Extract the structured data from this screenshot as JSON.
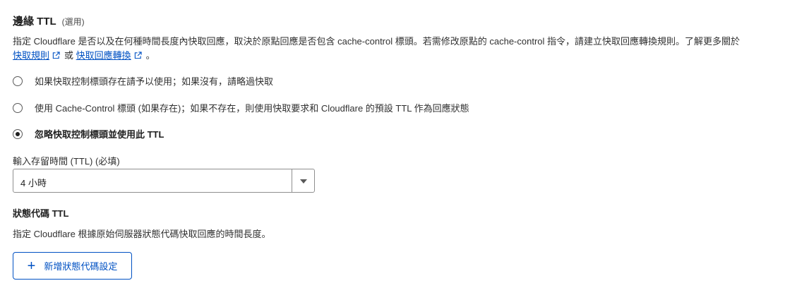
{
  "header": {
    "title": "邊緣 TTL",
    "optional": "(選用)"
  },
  "description": {
    "text_before": "指定 Cloudflare 是否以及在何種時間長度內快取回應，取決於原點回應是否包含 cache-control 標頭。若需修改原點的 cache-control 指令，請建立快取回應轉換規則。了解更多關於",
    "link1": "快取規則",
    "connector": "或",
    "link2": "快取回應轉換",
    "text_end": "。"
  },
  "options": [
    {
      "label": "如果快取控制標頭存在請予以使用；如果沒有，請略過快取",
      "checked": false
    },
    {
      "label": "使用 Cache-Control 標頭 (如果存在)；如果不存在，則使用快取要求和 Cloudflare 的預設 TTL 作為回應狀態",
      "checked": false
    },
    {
      "label": "忽略快取控制標頭並使用此 TTL",
      "checked": true
    }
  ],
  "ttl_field": {
    "label": "輸入存留時間 (TTL) (必填)",
    "value": "4 小時"
  },
  "status_section": {
    "title": "狀態代碼 TTL",
    "description": "指定 Cloudflare 根據原始伺服器狀態代碼快取回應的時間長度。",
    "add_button": "新增狀態代碼設定"
  },
  "colors": {
    "link": "#0051c3",
    "text": "#313131",
    "border": "#8f8f8f"
  }
}
